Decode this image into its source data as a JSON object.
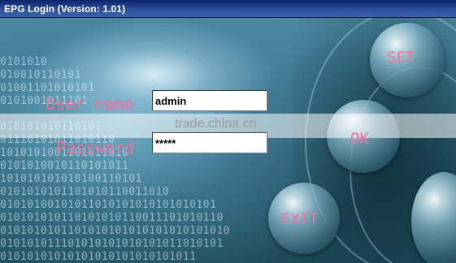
{
  "window": {
    "title": "EPG Login (Version: 1.01)"
  },
  "form": {
    "username_label": "User name",
    "username_value": "admin",
    "password_label": "Password",
    "password_value": "*****"
  },
  "buttons": {
    "set": "SET",
    "ok": "OK",
    "exit": "EXIT"
  },
  "watermark": "trade.china.cn",
  "background": {
    "binary_rows": [
      "0101010",
      "010010110101",
      "01001101010101",
      "0101001011101",
      "010101010110101",
      "01110101011010110",
      "1010101001101011010",
      "0101010010110101011",
      "101010101010100110101",
      "0101010101101010110011010",
      "01010100101011010101010101010101",
      "010101010110101010110011101010110",
      "0101010101101010101010101010101010",
      "010101011101010101010101011010101",
      "01010101010101010101010101011"
    ]
  },
  "colors": {
    "label_pink": "#f07aa6",
    "titlebar": "#0a246a"
  }
}
